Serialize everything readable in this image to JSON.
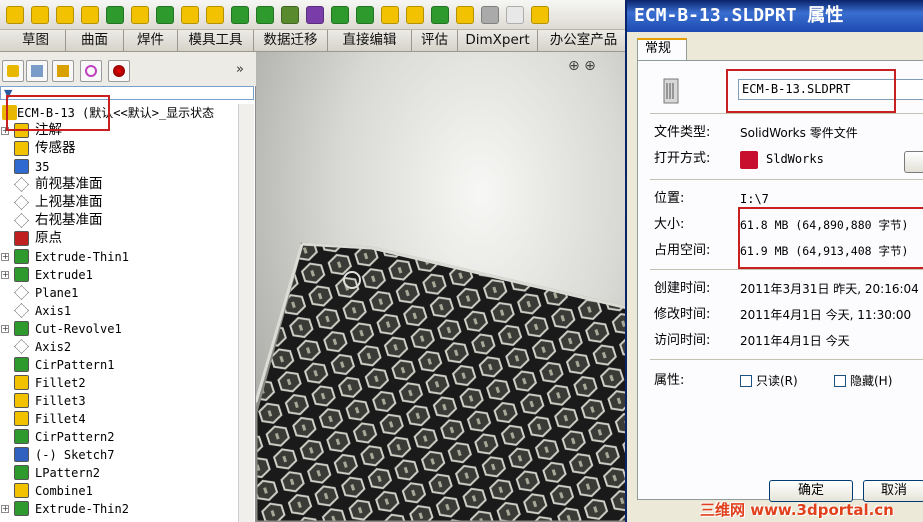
{
  "toolbar_tabs": [
    "草图",
    "曲面",
    "焊件",
    "模具工具",
    "数据迁移",
    "直接编辑",
    "评估",
    "DimXpert",
    "办公室产品"
  ],
  "feature_tree": {
    "root": "ECM-B-13  (默认<<默认>_显示状态",
    "items": [
      {
        "label": "注解",
        "expand": true,
        "cn": true
      },
      {
        "label": "传感器",
        "expand": false,
        "cn": true
      },
      {
        "label": "35",
        "expand": false,
        "cn": false
      },
      {
        "label": "前视基准面",
        "expand": false,
        "cn": true
      },
      {
        "label": "上视基准面",
        "expand": false,
        "cn": true
      },
      {
        "label": "右视基准面",
        "expand": false,
        "cn": true
      },
      {
        "label": "原点",
        "expand": false,
        "cn": true
      },
      {
        "label": "Extrude-Thin1",
        "expand": true,
        "cn": false
      },
      {
        "label": "Extrude1",
        "expand": true,
        "cn": false
      },
      {
        "label": "Plane1",
        "expand": false,
        "cn": false
      },
      {
        "label": "Axis1",
        "expand": false,
        "cn": false
      },
      {
        "label": "Cut-Revolve1",
        "expand": true,
        "cn": false
      },
      {
        "label": "Axis2",
        "expand": false,
        "cn": false
      },
      {
        "label": "CirPattern1",
        "expand": false,
        "cn": false
      },
      {
        "label": "Fillet2",
        "expand": false,
        "cn": false
      },
      {
        "label": "Fillet3",
        "expand": false,
        "cn": false
      },
      {
        "label": "Fillet4",
        "expand": false,
        "cn": false
      },
      {
        "label": "CirPattern2",
        "expand": false,
        "cn": false
      },
      {
        "label": "(-) Sketch7",
        "expand": false,
        "cn": false
      },
      {
        "label": "LPattern2",
        "expand": false,
        "cn": false
      },
      {
        "label": "Combine1",
        "expand": false,
        "cn": false
      },
      {
        "label": "Extrude-Thin2",
        "expand": true,
        "cn": false
      }
    ]
  },
  "fm_more": "»",
  "dialog": {
    "title": "ECM-B-13.SLDPRT 属性",
    "tab": "常规",
    "filename": "ECM-B-13.SLDPRT",
    "type_label": "文件类型:",
    "type_value": "SolidWorks 零件文件",
    "open_label": "打开方式:",
    "open_value": "SldWorks",
    "loc_label": "位置:",
    "loc_value": "I:\\7",
    "size_label": "大小:",
    "size_value": "61.8 MB (64,890,880 字节)",
    "disk_label": "占用空间:",
    "disk_value": "61.9 MB (64,913,408 字节)",
    "created_label": "创建时间:",
    "created_value": "2011年3月31日 昨天, 20:16:04",
    "modified_label": "修改时间:",
    "modified_value": "2011年4月1日 今天, 11:30:00",
    "accessed_label": "访问时间:",
    "accessed_value": "2011年4月1日 今天",
    "attr_label": "属性:",
    "readonly_label": "只读(R)",
    "hidden_label": "隐藏(H)",
    "ok": "确定",
    "cancel": "取消"
  },
  "watermark": "三维网 www.3dportal.cn",
  "colors": {
    "title_bar": "#0a246a",
    "highlight_box": "#c82020",
    "accent_yellow": "#f2c200",
    "accent_green": "#2e9a2e"
  }
}
